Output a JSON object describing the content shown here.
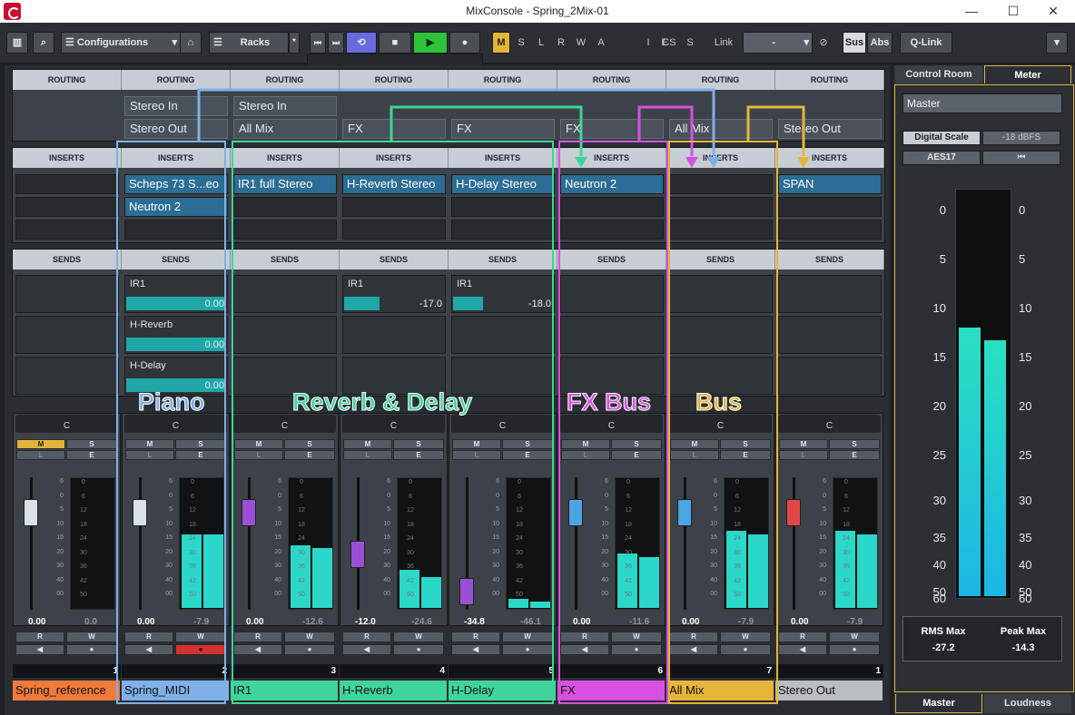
{
  "window": {
    "title": "MixConsole - Spring_2Mix-01",
    "minimize": "—",
    "maximize": "☐",
    "close": "✕"
  },
  "toolbar": {
    "configurations": "Configurations",
    "racks": "Racks",
    "racks_star": "*",
    "modes": [
      "M",
      "S",
      "L",
      "R",
      "W",
      "A"
    ],
    "views": [
      "I",
      "E",
      "CS",
      "S"
    ],
    "link_label": "Link",
    "link_value": "-",
    "sus": "Sus",
    "abs": "Abs",
    "qlink": "Q-Link",
    "active_mode": "M",
    "accent_colors": {
      "mode_active": "#e1b53a",
      "cycle": "#6a6adf",
      "play": "#2dc43a"
    }
  },
  "sections": {
    "routing": "ROUTING",
    "inserts": "INSERTS",
    "sends": "SENDS"
  },
  "routing": [
    {
      "in": "",
      "out": ""
    },
    {
      "in": "Stereo In",
      "out": "Stereo Out"
    },
    {
      "in": "Stereo In",
      "out": "All Mix"
    },
    {
      "in": "",
      "out": "FX"
    },
    {
      "in": "",
      "out": "FX"
    },
    {
      "in": "",
      "out": "FX"
    },
    {
      "in": "",
      "out": "All Mix"
    },
    {
      "in": "",
      "out": "Stereo Out"
    }
  ],
  "inserts": [
    [],
    [
      "Scheps 73 S...eo",
      "Neutron 2"
    ],
    [
      "IR1 full Stereo"
    ],
    [
      "H-Reverb Stereo"
    ],
    [
      "H-Delay Stereo"
    ],
    [
      "Neutron 2"
    ],
    [],
    [
      "SPAN"
    ]
  ],
  "sends": [
    [],
    [
      {
        "name": "IR1",
        "value": "0.00",
        "level": 1.0
      },
      {
        "name": "H-Reverb",
        "value": "0.00",
        "level": 1.0
      },
      {
        "name": "H-Delay",
        "value": "0.00",
        "level": 1.0
      }
    ],
    [],
    [
      {
        "name": "IR1",
        "value": "-17.0",
        "level": 0.35
      }
    ],
    [
      {
        "name": "IR1",
        "value": "-18.0",
        "level": 0.3
      }
    ],
    [],
    [],
    []
  ],
  "group_labels": {
    "piano": {
      "text": "Piano",
      "color": "#7fb0e8"
    },
    "reverb_delay": {
      "text": "Reverb & Delay",
      "color": "#3fd59a"
    },
    "fx_bus": {
      "text": "FX Bus",
      "color": "#d651e0"
    },
    "bus": {
      "text": "Bus",
      "color": "#e6b53a"
    }
  },
  "channels": [
    {
      "name": "Spring_reference",
      "number": "1",
      "color": "#f07a3a",
      "pan": "C",
      "volume": "0.00",
      "peak": "0.0",
      "fader": 0.73,
      "cap": "#d8e2ea",
      "mute": true,
      "write": false,
      "meter": [
        0.0,
        0.0
      ]
    },
    {
      "name": "Spring_MIDI",
      "number": "2",
      "color": "#7fb0e8",
      "pan": "C",
      "volume": "0.00",
      "peak": "-7.9",
      "fader": 0.73,
      "cap": "#d8e2ea",
      "mute": false,
      "write": true,
      "meter": [
        0.58,
        0.58
      ]
    },
    {
      "name": "IR1",
      "number": "3",
      "color": "#3fd59a",
      "pan": "C",
      "volume": "0.00",
      "peak": "-12.6",
      "fader": 0.73,
      "cap": "#9b4fd6",
      "mute": false,
      "write": false,
      "meter": [
        0.49,
        0.47
      ]
    },
    {
      "name": "H-Reverb",
      "number": "4",
      "color": "#3fd59a",
      "pan": "C",
      "volume": "-12.0",
      "peak": "-24.6",
      "fader": 0.42,
      "cap": "#9b4fd6",
      "mute": false,
      "write": false,
      "meter": [
        0.3,
        0.24
      ]
    },
    {
      "name": "H-Delay",
      "number": "5",
      "color": "#3fd59a",
      "pan": "C",
      "volume": "-34.8",
      "peak": "-46.1",
      "fader": 0.14,
      "cap": "#9b4fd6",
      "mute": false,
      "write": false,
      "meter": [
        0.07,
        0.05
      ]
    },
    {
      "name": "FX",
      "number": "6",
      "color": "#d651e0",
      "pan": "C",
      "volume": "0.00",
      "peak": "-11.6",
      "fader": 0.73,
      "cap": "#4aa6e6",
      "mute": false,
      "write": false,
      "meter": [
        0.43,
        0.4
      ]
    },
    {
      "name": "All Mix",
      "number": "7",
      "color": "#e6b53a",
      "pan": "C",
      "volume": "0.00",
      "peak": "-7.9",
      "fader": 0.73,
      "cap": "#4aa6e6",
      "mute": false,
      "write": false,
      "meter": [
        0.61,
        0.58
      ]
    },
    {
      "name": "Stereo Out",
      "number": "1",
      "color": "#b9bec3",
      "pan": "C",
      "volume": "0.00",
      "peak": "-7.9",
      "fader": 0.73,
      "cap": "#e04848",
      "mute": false,
      "write": false,
      "meter": [
        0.61,
        0.58
      ]
    }
  ],
  "strip_labels": {
    "mute": "M",
    "solo": "S",
    "listen": "L",
    "edit": "E",
    "read": "R",
    "write": "W",
    "fader_scale": [
      "6",
      "0",
      "5",
      "10",
      "15",
      "20",
      "30",
      "40",
      "00"
    ],
    "meter_scale": [
      "0",
      "6",
      "12",
      "18",
      "24",
      "30",
      "36",
      "42",
      "50"
    ]
  },
  "right_panel": {
    "tabs": [
      "Control Room",
      "Meter"
    ],
    "active_tab": "Meter",
    "master": "Master",
    "digital_scale": "Digital Scale",
    "dbfs": "-18 dBFS",
    "aes": "AES17",
    "reset": "⏮",
    "scale": [
      "0",
      "5",
      "10",
      "15",
      "20",
      "25",
      "30",
      "35",
      "40",
      "50",
      "60"
    ],
    "meter_levels": [
      0.66,
      0.63
    ],
    "rms_label": "RMS Max",
    "rms_value": "-27.2",
    "peak_label": "Peak Max",
    "peak_value": "-14.3",
    "bottom_tabs": [
      "Master",
      "Loudness"
    ]
  }
}
